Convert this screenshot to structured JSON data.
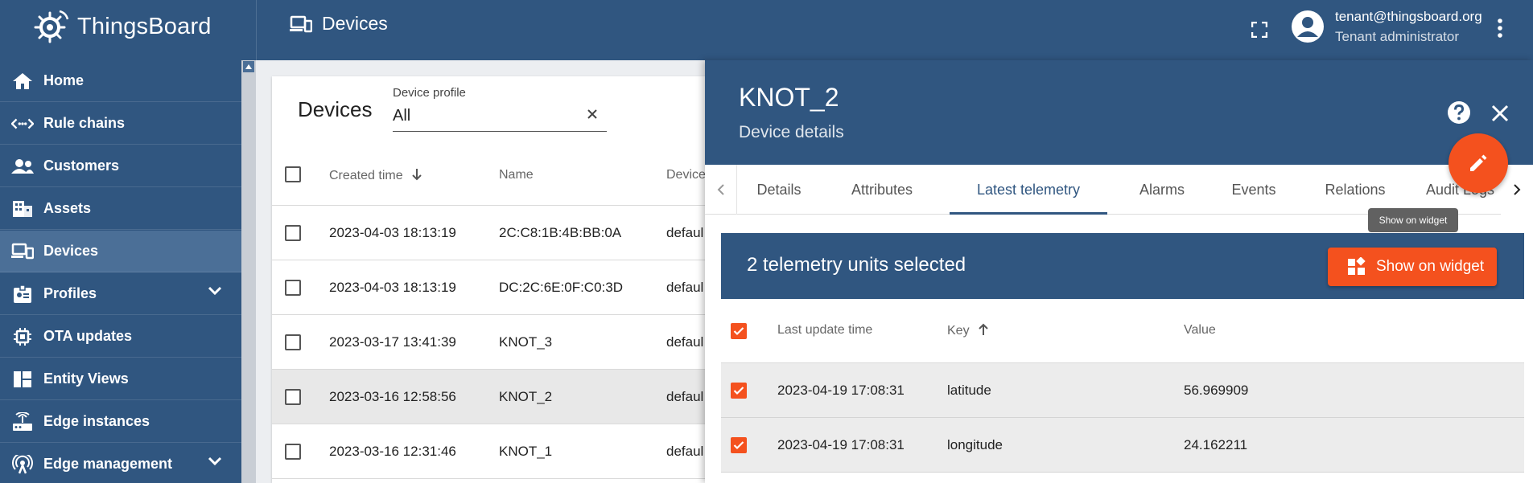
{
  "app": {
    "logo_text": "ThingsBoard"
  },
  "header": {
    "page_title": "Devices",
    "user_name": "tenant@thingsboard.org",
    "user_role": "Tenant administrator"
  },
  "sidebar": {
    "items": [
      {
        "label": "Home",
        "icon": "home-icon"
      },
      {
        "label": "Rule chains",
        "icon": "rule-chains-icon"
      },
      {
        "label": "Customers",
        "icon": "customers-icon"
      },
      {
        "label": "Assets",
        "icon": "assets-icon"
      },
      {
        "label": "Devices",
        "icon": "devices-icon",
        "active": true
      },
      {
        "label": "Profiles",
        "icon": "profiles-icon",
        "expandable": true
      },
      {
        "label": "OTA updates",
        "icon": "ota-icon"
      },
      {
        "label": "Entity Views",
        "icon": "entity-views-icon"
      },
      {
        "label": "Edge instances",
        "icon": "edge-instances-icon"
      },
      {
        "label": "Edge management",
        "icon": "edge-management-icon",
        "expandable": true
      }
    ]
  },
  "devices_table": {
    "title": "Devices",
    "filter": {
      "label": "Device profile",
      "value": "All"
    },
    "columns": [
      "Created time",
      "Name",
      "Device"
    ],
    "rows": [
      {
        "created": "2023-04-03 18:13:19",
        "name": "2C:C8:1B:4B:BB:0A",
        "profile": "defaul"
      },
      {
        "created": "2023-04-03 18:13:19",
        "name": "DC:2C:6E:0F:C0:3D",
        "profile": "defaul"
      },
      {
        "created": "2023-03-17 13:41:39",
        "name": "KNOT_3",
        "profile": "defaul"
      },
      {
        "created": "2023-03-16 12:58:56",
        "name": "KNOT_2",
        "profile": "defaul"
      },
      {
        "created": "2023-03-16 12:31:46",
        "name": "KNOT_1",
        "profile": "defaul"
      }
    ]
  },
  "details": {
    "title": "KNOT_2",
    "subtitle": "Device details",
    "tabs": [
      "Details",
      "Attributes",
      "Latest telemetry",
      "Alarms",
      "Events",
      "Relations",
      "Audit Logs"
    ],
    "active_tab": "Latest telemetry",
    "tooltip": "Show on widget",
    "selection_text": "2 telemetry units selected",
    "show_widget_label": "Show on widget",
    "telemetry_columns": [
      "Last update time",
      "Key",
      "Value"
    ],
    "telemetry_rows": [
      {
        "time": "2023-04-19 17:08:31",
        "key": "latitude",
        "value": "56.969909"
      },
      {
        "time": "2023-04-19 17:08:31",
        "key": "longitude",
        "value": "24.162211"
      }
    ]
  },
  "colors": {
    "primary": "#305680",
    "accent": "#f4511e",
    "active_nav": "#4b6f97"
  }
}
